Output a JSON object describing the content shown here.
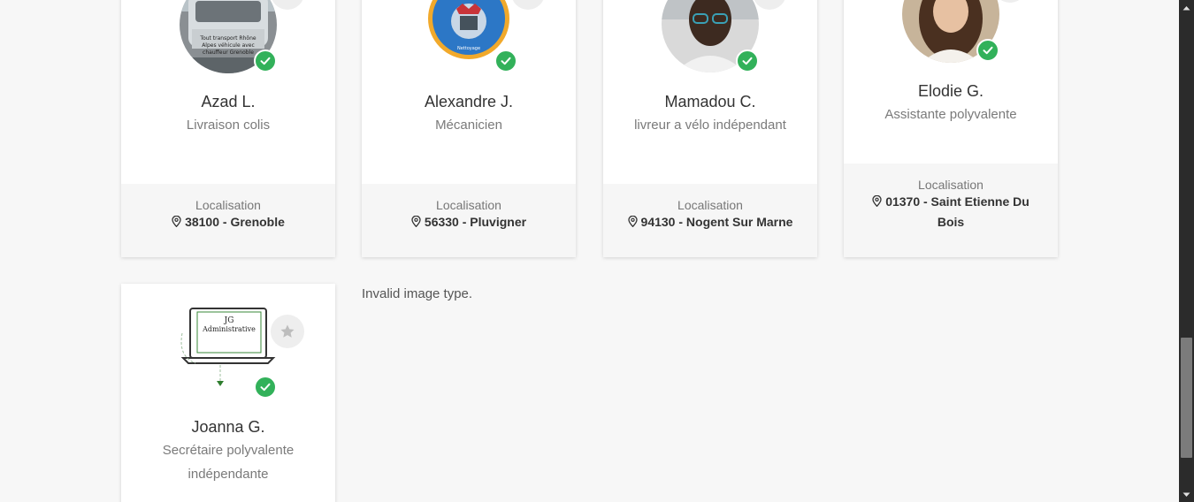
{
  "cards": [
    {
      "name": "Azad L.",
      "job": "Livraison colis",
      "location_label": "Localisation",
      "location": "38100 - Grenoble",
      "avatar_text": "Tout transport Rhône-Alpes véhicule avec chauffeur Grenoble"
    },
    {
      "name": "Alexandre J.",
      "job": "Mécanicien",
      "location_label": "Localisation",
      "location": "56330 - Pluvigner",
      "avatar_text": "BZH AUTO REDO"
    },
    {
      "name": "Mamadou C.",
      "job": "livreur a vélo indépendant",
      "location_label": "Localisation",
      "location": "94130 - Nogent Sur Marne"
    },
    {
      "name": "Elodie G.",
      "job": "Assistante polyvalente",
      "location_label": "Localisation",
      "location": "01370 - Saint Etienne Du Bois"
    },
    {
      "name": "Joanna G.",
      "job": "Secrétaire polyvalente indépendante",
      "avatar_text": "JG Administrative"
    }
  ],
  "invalid_message": "Invalid image type.",
  "colors": {
    "verified": "#32b15a",
    "background": "#f7f7f7",
    "card_footer": "#f6f6f6"
  },
  "icons": {
    "verified": "check-icon",
    "favorite": "star-icon",
    "location": "map-pin-icon"
  }
}
